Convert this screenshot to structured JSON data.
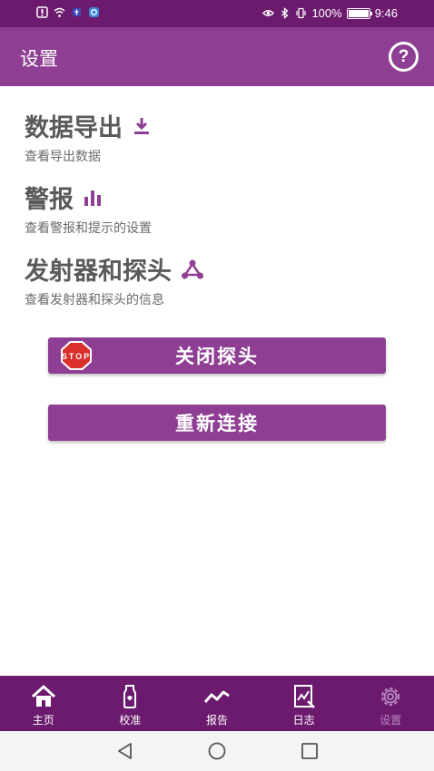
{
  "status_bar": {
    "battery_text": "100%",
    "time": "9:46",
    "battery_level": 1.0
  },
  "app_bar": {
    "title": "设置",
    "help_icon": "help-circle-icon",
    "help_glyph": "?"
  },
  "items": [
    {
      "title": "数据导出",
      "subtitle": "查看导出数据",
      "icon": "download-icon"
    },
    {
      "title": "警报",
      "subtitle": "查看警报和提示的设置",
      "icon": "bar-chart-icon"
    },
    {
      "title": "发射器和探头",
      "subtitle": "查看发射器和探头的信息",
      "icon": "network-icon"
    }
  ],
  "buttons": {
    "close_probe": "关闭探头",
    "reconnect": "重新连接",
    "stop_sign_text": "STOP"
  },
  "bottom_nav": [
    {
      "label": "主页",
      "icon": "home-icon",
      "active": false
    },
    {
      "label": "校准",
      "icon": "calibrate-icon",
      "active": false
    },
    {
      "label": "报告",
      "icon": "trend-icon",
      "active": false
    },
    {
      "label": "日志",
      "icon": "log-icon",
      "active": false
    },
    {
      "label": "设置",
      "icon": "gear-icon",
      "active": true
    }
  ],
  "colors": {
    "primary": "#8f3f93",
    "dark": "#6c1a6e",
    "active_tab": "#b98bc0"
  }
}
